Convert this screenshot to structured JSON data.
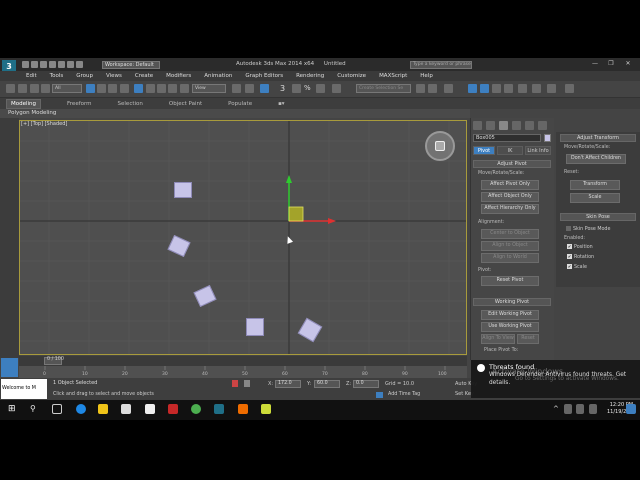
{
  "app": {
    "logo": "3",
    "workspace": "Workspace: Default",
    "title": "Autodesk 3ds Max  2014 x64",
    "doc": "Untitled",
    "search_placeholder": "Type a keyword or phrase"
  },
  "menu": [
    "Edit",
    "Tools",
    "Group",
    "Views",
    "Create",
    "Modifiers",
    "Animation",
    "Graph Editors",
    "Rendering",
    "Customize",
    "MAXScript",
    "Help"
  ],
  "toolbar": {
    "selection_filter": "All",
    "view": "View",
    "selection_set": "Create Selection Se",
    "snap_label": "3",
    "snap_percent": "%"
  },
  "ribbon": {
    "tabs": [
      "Modeling",
      "Freeform",
      "Selection",
      "Object Paint",
      "Populate"
    ],
    "subbar": "Polygon Modeling"
  },
  "viewport": {
    "label": "[+] [Top] [Shaded]"
  },
  "command_panel": {
    "object_name": "Box005",
    "subtabs": [
      "Pivot",
      "IK",
      "Link Info"
    ],
    "adjust_pivot": {
      "header": "Adjust Pivot",
      "group": "Move/Rotate/Scale:",
      "buttons": [
        "Affect Pivot Only",
        "Affect Object Only",
        "Affect Hierarchy Only"
      ]
    },
    "alignment": {
      "group": "Alignment:",
      "buttons": [
        "Center to Object",
        "Align to Object",
        "Align to World"
      ]
    },
    "pivot": {
      "group": "Pivot:",
      "button": "Reset Pivot"
    },
    "working_pivot": {
      "header": "Working Pivot",
      "buttons": [
        "Edit Working Pivot",
        "Use Working Pivot",
        "Align To View",
        "Reset"
      ],
      "place": "Place Pivot To:"
    }
  },
  "transform_panel": {
    "header": "Adjust Transform",
    "group": "Move/Rotate/Scale:",
    "dont_affect": "Don't Affect Children",
    "reset_label": "Reset:",
    "transform": "Transform",
    "scale": "Scale",
    "skin_header": "Skin Pose",
    "skin_mode": "Skin Pose Mode",
    "enabled_label": "Enabled:",
    "checks": [
      "Position",
      "Rotation",
      "Scale"
    ]
  },
  "timeline": {
    "frame": "0 / 100",
    "ticks": [
      "0",
      "10",
      "20",
      "30",
      "40",
      "50",
      "60",
      "70",
      "80",
      "90",
      "100"
    ]
  },
  "status": {
    "listener": "Welcome to M",
    "objects": "1 Object Selected",
    "hint": "Click and drag to select and move objects",
    "x_label": "X:",
    "x_val": "172.0",
    "y_label": "Y:",
    "y_val": "60.0",
    "z_label": "Z:",
    "z_val": "0.0",
    "grid": "Grid = 10.0",
    "add_time_tag": "Add Time Tag",
    "auto_key": "Auto Key",
    "set_key": "Set Key"
  },
  "notification": {
    "title": "Threats found",
    "body": "Windows Defender Antivirus found threats. Get details.",
    "watermark": "Activate Windows",
    "watermark_sub": "Go to Settings to activate Windows."
  },
  "taskbar": {
    "time": "12:20 PM",
    "date": "11/19/2017"
  },
  "colors": {
    "accent": "#3d7fc0",
    "viewport_bg": "#4f4f4f",
    "box_fill": "#c7c4e8",
    "gizmo_yellow": "#b8b820"
  }
}
